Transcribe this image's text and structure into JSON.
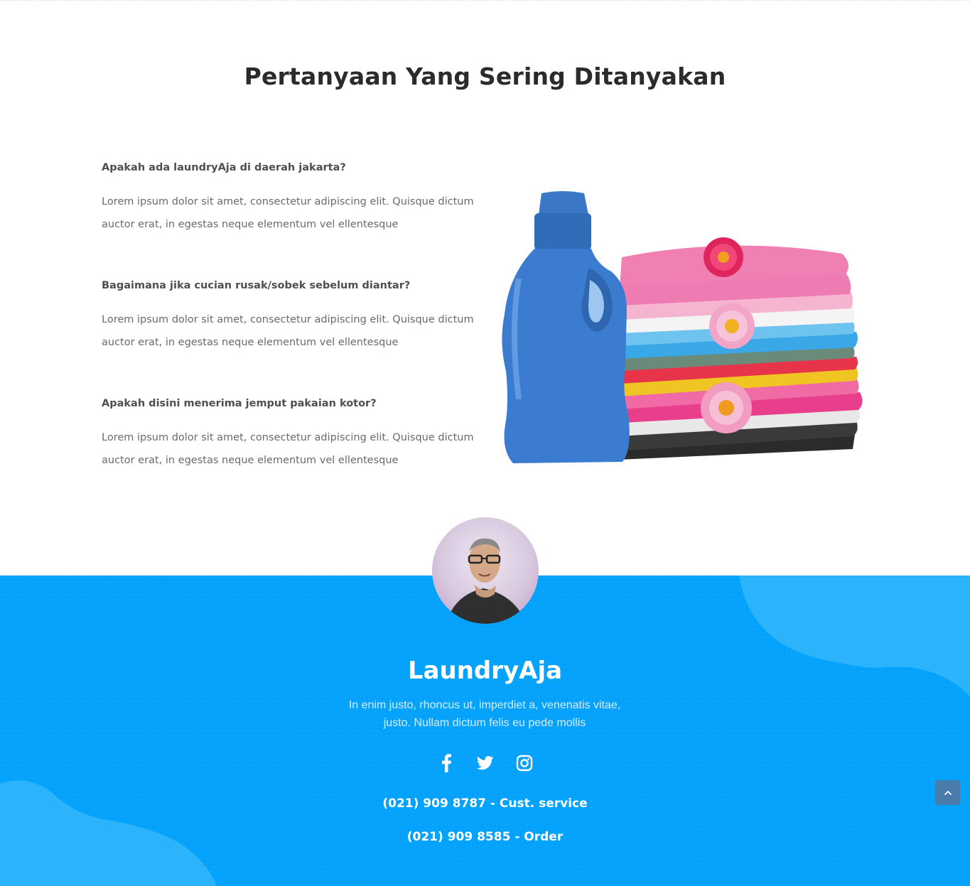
{
  "faq": {
    "title": "Pertanyaan Yang Sering Ditanyakan",
    "items": [
      {
        "question": "Apakah ada laundryAja di daerah jakarta?",
        "answer": "Lorem ipsum dolor sit amet, consectetur adipiscing elit. Quisque dictum auctor erat, in egestas neque elementum vel ellentesque"
      },
      {
        "question": "Bagaimana jika cucian rusak/sobek sebelum diantar?",
        "answer": "Lorem ipsum dolor sit amet, consectetur adipiscing elit. Quisque dictum auctor erat, in egestas neque elementum vel ellentesque"
      },
      {
        "question": "Apakah disini menerima jemput pakaian kotor?",
        "answer": "Lorem ipsum dolor sit amet, consectetur adipiscing elit. Quisque dictum auctor erat, in egestas neque elementum vel ellentesque"
      }
    ]
  },
  "footer": {
    "brand": "LaundryAja",
    "tagline": "In enim justo, rhoncus ut, imperdiet a, venenatis vitae, justo. Nullam dictum felis eu pede mollis",
    "socials": [
      {
        "name": "facebook-icon"
      },
      {
        "name": "twitter-icon"
      },
      {
        "name": "instagram-icon"
      }
    ],
    "phones": [
      "(021) 909 8787 - Cust. service",
      "(021) 909 8585 - Order"
    ]
  },
  "colors": {
    "footer_bg": "#05a2fb",
    "heading": "#2b2b2b",
    "back_to_top": "#4a7bad"
  },
  "icons": {
    "back_to_top": "chevron-up-icon"
  }
}
